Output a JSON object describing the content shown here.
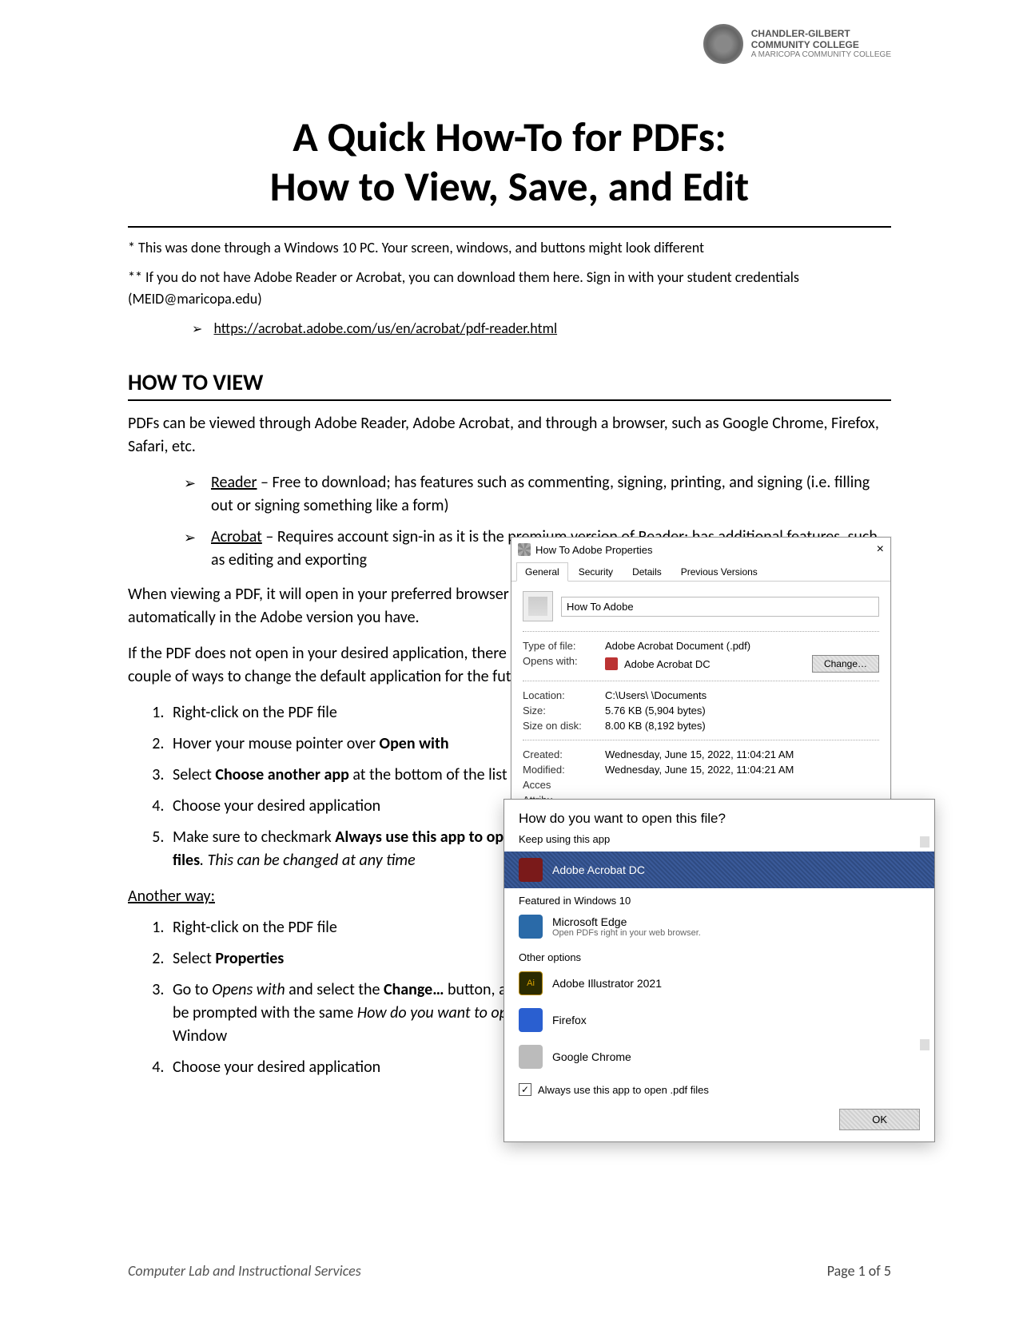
{
  "logo": {
    "line1": "CHANDLER-GILBERT",
    "line2": "COMMUNITY COLLEGE",
    "sub": "A MARICOPA COMMUNITY COLLEGE"
  },
  "title_line1": "A Quick How-To for PDFs:",
  "title_line2": "How to View, Save, and Edit",
  "note1": "* This was done through a Windows 10 PC. Your screen, windows, and buttons might look different",
  "note2": "** If you do not have Adobe Reader or Acrobat, you can download them here. Sign in with your student credentials (MEID@maricopa.edu)",
  "download_link": "https://acrobat.adobe.com/us/en/acrobat/pdf-reader.html",
  "section_how_to_view": "HOW TO VIEW",
  "view_intro": "PDFs can be viewed through Adobe Reader, Adobe Acrobat, and through a browser, such as Google Chrome, Firefox, Safari, etc.",
  "reader_label": "Reader",
  "reader_desc": " – Free to download; has features such as commenting, signing, printing, and signing (i.e. filling out or signing something like a form)",
  "acrobat_label": "Acrobat",
  "acrobat_desc": " – Requires account sign-in as it is the premium version of Reader; has additional features, such as editing and exporting",
  "open_pref": "When viewing a PDF, it will open in your preferred browser or automatically in the Adobe version you have.",
  "if_not_open": "If the PDF does not open in your desired application, there are a couple of ways to change the default application for the future:",
  "steps_a": {
    "s1": "Right-click on the PDF file",
    "s2_pre": "Hover your mouse pointer over ",
    "s2_b": "Open with",
    "s3_pre": "Select ",
    "s3_b": "Choose another app",
    "s3_post": " at the bottom of the list",
    "s4": "Choose your desired application",
    "s5_pre": "Make sure to checkmark ",
    "s5_b": "Always use this app to open .pdf files",
    "s5_post_i": ". This can be changed at any time"
  },
  "another_way_label": "Another way:",
  "steps_b": {
    "s1": "Right-click on the PDF file",
    "s2_pre": "Select ",
    "s2_b": "Properties",
    "s3_pre": "Go to ",
    "s3_i": "Opens with",
    "s3_mid": " and select the ",
    "s3_b": "Change…",
    "s3_post": " button, and you will be prompted with the same ",
    "s3_i2": "How do you want to open this file?",
    "s3_tail": " Window",
    "s4": "Choose your desired application"
  },
  "props": {
    "title": "How To Adobe Properties",
    "tabs": [
      "General",
      "Security",
      "Details",
      "Previous Versions"
    ],
    "filename": "How To Adobe",
    "type_of_file_k": "Type of file:",
    "type_of_file_v": "Adobe Acrobat Document (.pdf)",
    "opens_with_k": "Opens with:",
    "opens_with_v": "Adobe Acrobat DC",
    "change_btn": "Change…",
    "location_k": "Location:",
    "location_v": "C:\\Users\\             \\Documents",
    "size_k": "Size:",
    "size_v": "5.76 KB (5,904 bytes)",
    "size_on_disk_k": "Size on disk:",
    "size_on_disk_v": "8.00 KB (8,192 bytes)",
    "created_k": "Created:",
    "created_v": "Wednesday, June 15, 2022, 11:04:21 AM",
    "modified_k": "Modified:",
    "modified_v": "Wednesday, June 15, 2022, 11:04:21 AM",
    "accessed_k": "Acces",
    "attributes_k": "Attribu"
  },
  "openwith": {
    "heading": "How do you want to open this file?",
    "keep_using": "Keep using this app",
    "acrobat": "Adobe Acrobat DC",
    "featured": "Featured in Windows 10",
    "edge": "Microsoft Edge",
    "edge_sub": "Open PDFs right in your web browser.",
    "other": "Other options",
    "ai": "Adobe Illustrator 2021",
    "ai_badge": "Ai",
    "ff": "Firefox",
    "gc": "Google Chrome",
    "always": "Always use this app to open .pdf files",
    "ok": "OK"
  },
  "footer": {
    "left": "Computer Lab and Instructional Services",
    "right": "Page 1 of 5"
  }
}
